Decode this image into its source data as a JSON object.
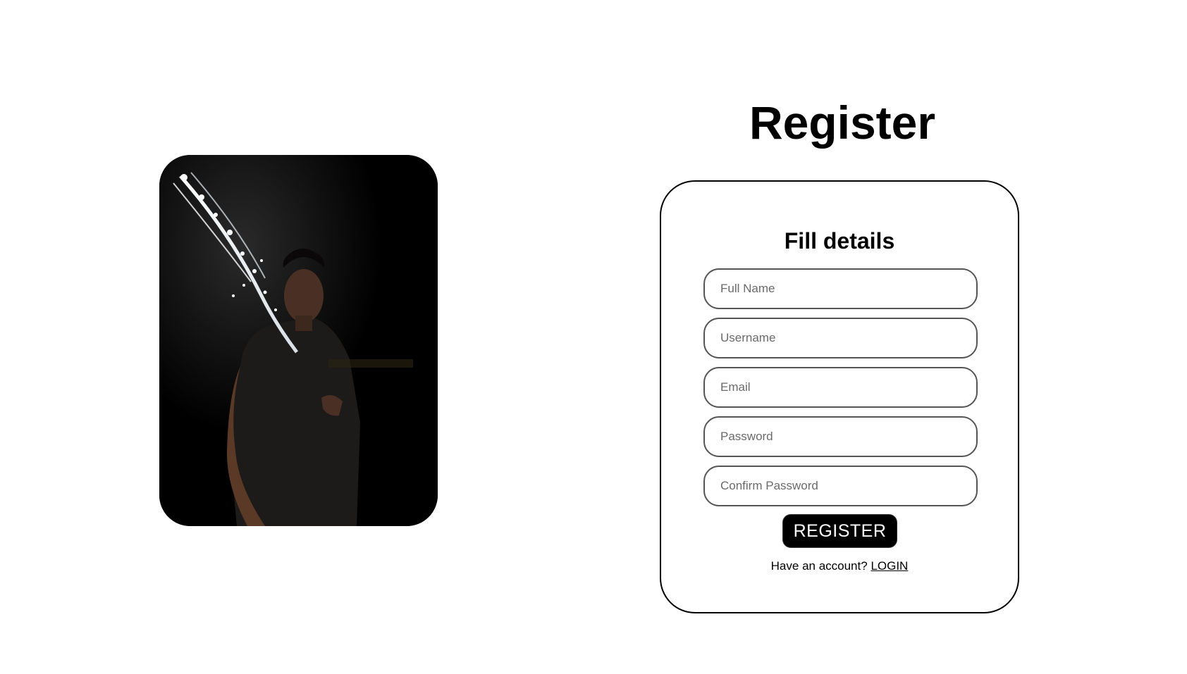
{
  "page": {
    "title": "Register"
  },
  "form": {
    "heading": "Fill details",
    "fields": {
      "full_name": {
        "placeholder": "Full Name",
        "value": ""
      },
      "username": {
        "placeholder": "Username",
        "value": ""
      },
      "email": {
        "placeholder": "Email",
        "value": ""
      },
      "password": {
        "placeholder": "Password",
        "value": ""
      },
      "confirm_password": {
        "placeholder": "Confirm Password",
        "value": ""
      }
    },
    "submit_label": "REGISTER",
    "account_prompt": "Have an account?",
    "login_link": "LOGIN"
  },
  "colors": {
    "text": "#000000",
    "button_bg": "#000000",
    "button_text": "#ffffff",
    "border": "#000000",
    "background": "#ffffff"
  }
}
